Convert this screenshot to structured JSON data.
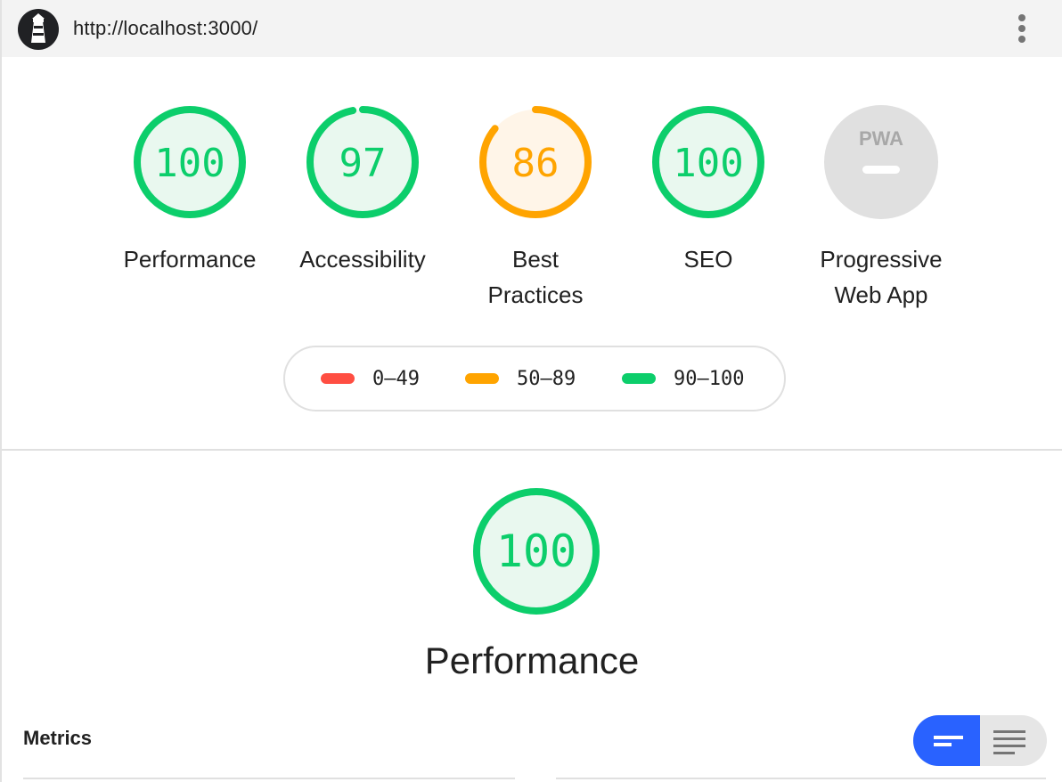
{
  "header": {
    "url": "http://localhost:3000/",
    "logo_icon": "lighthouse-icon",
    "menu_icon": "vertical-dots-icon"
  },
  "colors": {
    "pass": "#0cce6b",
    "average": "#ffa400",
    "fail": "#ff4e42",
    "pass_fill": "#e9f8ef",
    "average_fill": "#fff5e8",
    "pwa_fill": "#e0e0e0",
    "accent": "#2962ff"
  },
  "gauges": [
    {
      "score": "100",
      "label": "Performance",
      "value": 1.0,
      "rating": "pass"
    },
    {
      "score": "97",
      "label": "Accessibility",
      "value": 0.97,
      "rating": "pass"
    },
    {
      "score": "86",
      "label": "Best Practices",
      "value": 0.86,
      "rating": "average"
    },
    {
      "score": "100",
      "label": "SEO",
      "value": 1.0,
      "rating": "pass"
    }
  ],
  "pwa": {
    "badge_text": "PWA",
    "label": "Progressive Web App"
  },
  "legend": {
    "fail": "0–49",
    "average": "50–89",
    "pass": "90–100"
  },
  "section": {
    "score": "100",
    "value": 1.0,
    "title": "Performance"
  },
  "metrics": {
    "label": "Metrics",
    "toggle_compact_icon": "compact-view-icon",
    "toggle_expanded_icon": "expanded-view-icon"
  }
}
